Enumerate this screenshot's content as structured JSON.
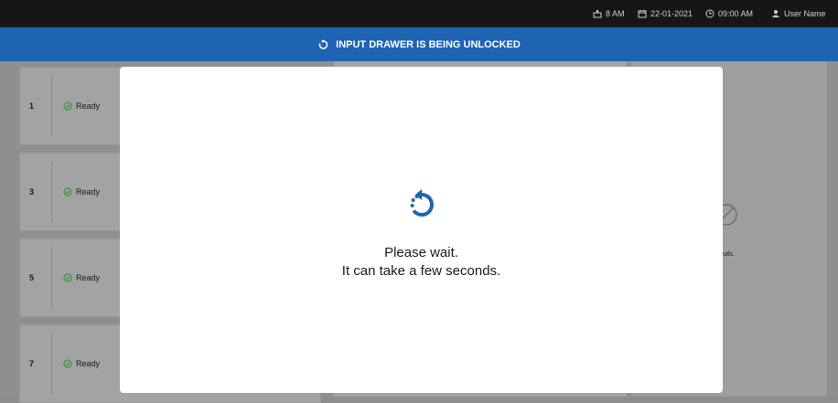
{
  "topbar": {
    "waste": "8 AM",
    "date": "22-01-2021",
    "time": "09:00 AM",
    "user": "User Name"
  },
  "banner": {
    "text": "INPUT DRAWER IS BEING UNLOCKED"
  },
  "cards": [
    {
      "number": "1",
      "status": "Ready"
    },
    {
      "number": "3",
      "status": "Ready"
    },
    {
      "number": "5",
      "status": "Ready"
    },
    {
      "number": "7",
      "status": "Ready"
    }
  ],
  "right_panel": {
    "text": "st resutls."
  },
  "modal": {
    "line1": "Please wait.",
    "line2": "It can take a few seconds."
  },
  "colors": {
    "accent": "#1f64b3",
    "topbar": "#161616",
    "ready": "#4caf50"
  }
}
